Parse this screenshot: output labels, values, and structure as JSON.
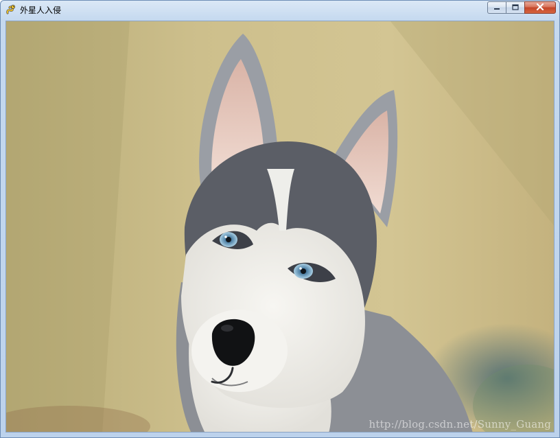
{
  "window": {
    "title": "外星人入侵"
  },
  "icons": {
    "app": "pygame-snake-icon",
    "minimize": "minimize-icon",
    "maximize": "maximize-icon",
    "close": "close-icon"
  },
  "content": {
    "watermark": "http://blog.csdn.net/Sunny_Guang"
  },
  "colors": {
    "close_button": "#c4452a",
    "frame": "#c5d9ef"
  }
}
